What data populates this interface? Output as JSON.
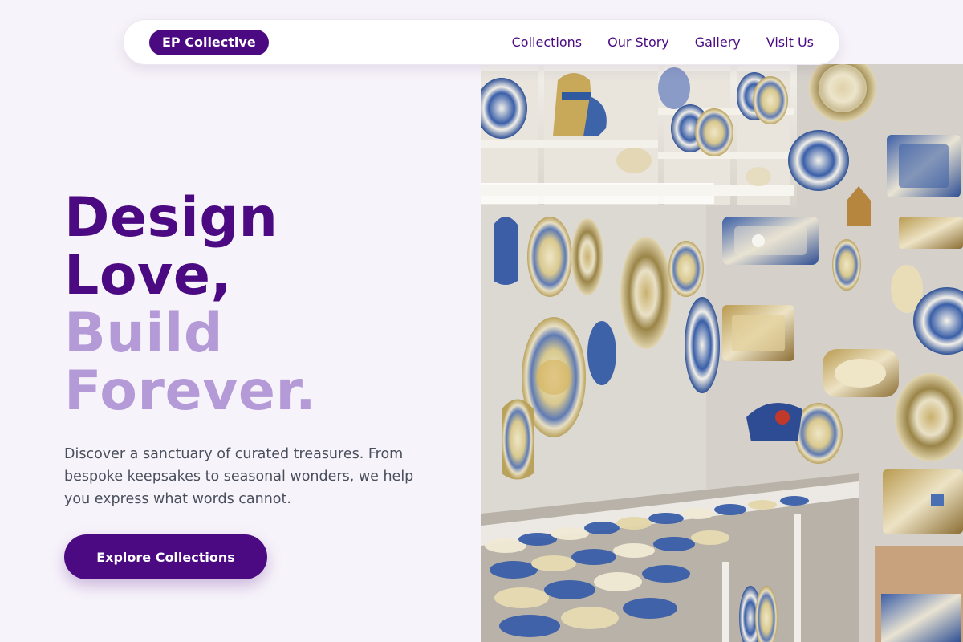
{
  "nav": {
    "brand": "EP Collective",
    "links": [
      "Collections",
      "Our Story",
      "Gallery",
      "Visit Us"
    ]
  },
  "hero": {
    "headline_dark": [
      "Design",
      "Love,"
    ],
    "headline_light": [
      "Build",
      "Forever."
    ],
    "description": "Discover a sanctuary of curated treasures. From bespoke keepsakes to seasonal wonders, we help you express what words cannot.",
    "cta_label": "Explore Collections",
    "image_alt": "Shop wall covered with hand-painted ceramic plates, pitchers and bowls"
  },
  "colors": {
    "primary": "#4b0a82",
    "accent_light": "#b49bd8",
    "background": "#f7f3fa",
    "body_text": "#4a4f5c"
  }
}
